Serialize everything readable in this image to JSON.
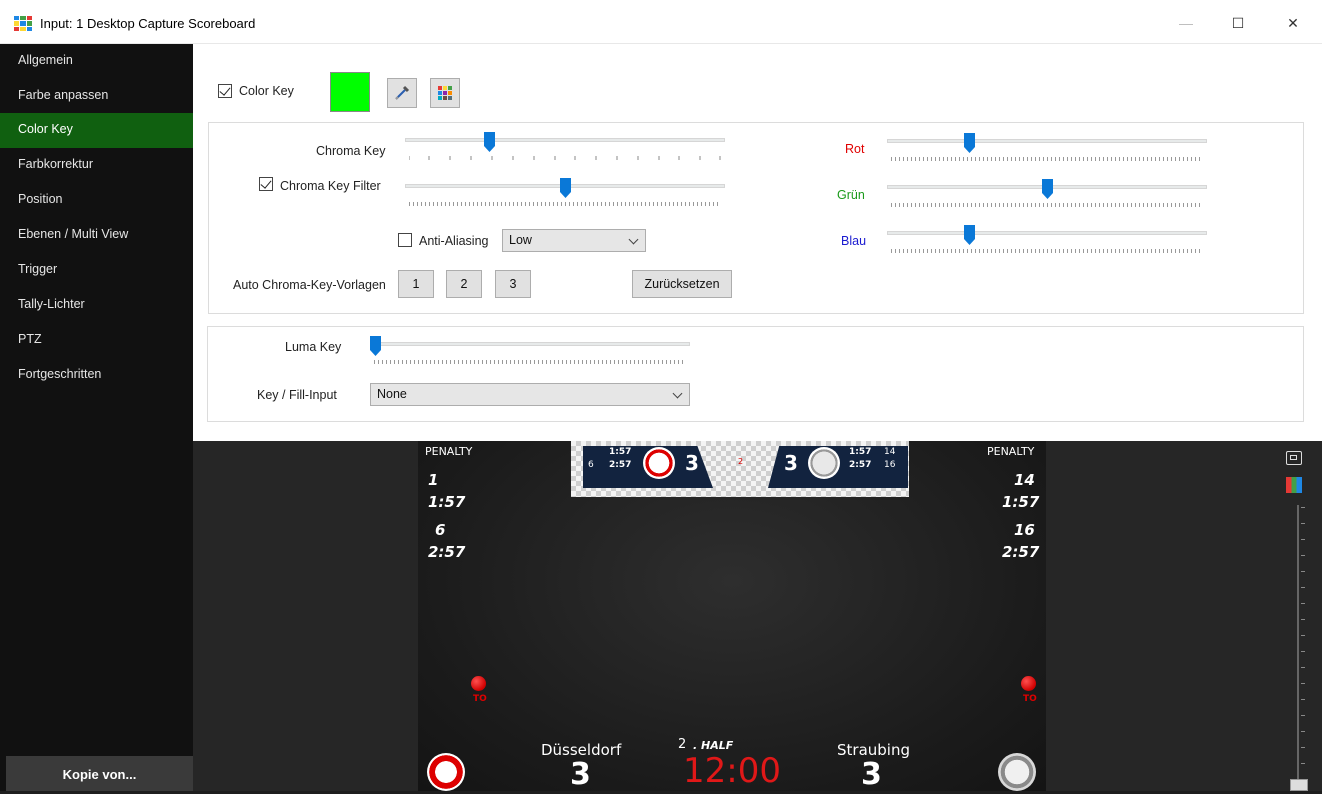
{
  "window": {
    "title": "Input: 1 Desktop Capture Scoreboard",
    "minimize": "—",
    "maximize": "☐",
    "close": "✕"
  },
  "sidebar": {
    "items": [
      {
        "label": "Allgemein"
      },
      {
        "label": "Farbe anpassen"
      },
      {
        "label": "Color Key",
        "active": true
      },
      {
        "label": "Farbkorrektur"
      },
      {
        "label": "Position"
      },
      {
        "label": "Ebenen / Multi View"
      },
      {
        "label": "Trigger"
      },
      {
        "label": "Tally-Lichter"
      },
      {
        "label": "PTZ"
      },
      {
        "label": "Fortgeschritten"
      }
    ],
    "copy_button": "Kopie von..."
  },
  "color_key": {
    "enabled_label": "Color Key",
    "enabled": true,
    "key_color": "#00ff00",
    "eyedropper_icon": "eyedropper-icon",
    "palette_icon": "color-palette-icon"
  },
  "chroma": {
    "chroma_key_label": "Chroma Key",
    "chroma_key_value": 0.27,
    "filter_label": "Chroma Key Filter",
    "filter_enabled": true,
    "filter_value": 0.5,
    "anti_aliasing_label": "Anti-Aliasing",
    "anti_aliasing_enabled": false,
    "anti_aliasing_value": "Low",
    "presets_label": "Auto Chroma-Key-Vorlagen",
    "presets": [
      "1",
      "2",
      "3"
    ],
    "reset_label": "Zurücksetzen",
    "red_label": "Rot",
    "red_value": 0.25,
    "red_color": "#e00000",
    "green_label": "Grün",
    "green_value": 0.5,
    "green_color": "#1a9a1a",
    "blue_label": "Blau",
    "blue_value": 0.25,
    "blue_color": "#1a1ad0"
  },
  "luma": {
    "luma_key_label": "Luma Key",
    "luma_key_value": 0.0,
    "key_fill_label": "Key / Fill-Input",
    "key_fill_value": "None"
  },
  "preview": {
    "penalty_left": "PENALTY",
    "penalty_right": "PENALTY",
    "left_pen1_num": "1",
    "left_pen1_time": "1:57",
    "left_pen2_num": "6",
    "left_pen2_time": "2:57",
    "right_pen1_num": "14",
    "right_pen1_time": "1:57",
    "right_pen2_num": "16",
    "right_pen2_time": "2:57",
    "mini_left_t1": "1:57",
    "mini_left_t2": "2:57",
    "mini_left_n": "6",
    "mini_left_score": "3",
    "mini_right_score": "3",
    "mini_right_t1": "1:57",
    "mini_right_t2": "2:57",
    "mini_right_n1": "14",
    "mini_right_n2": "16",
    "mini_center": "2",
    "timeout_label": "TO",
    "home_team": "Düsseldorf",
    "home_score": "3",
    "away_team": "Straubing",
    "away_score": "3",
    "period_num": "2",
    "period_label": ". HALF",
    "clock": "12:00"
  }
}
